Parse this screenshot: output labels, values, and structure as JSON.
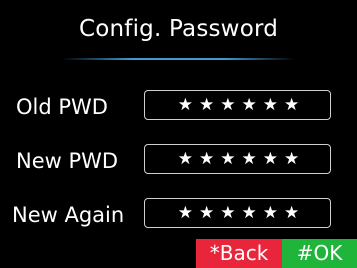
{
  "screen": {
    "title": "Config. Password"
  },
  "form": {
    "fields": [
      {
        "label": "Old PWD",
        "value": "★★★★★★"
      },
      {
        "label": "New PWD",
        "value": "★★★★★★"
      },
      {
        "label": "New Again",
        "value": "★★★★★★"
      }
    ]
  },
  "softkeys": {
    "back_label": "*Back",
    "ok_label": "#OK"
  },
  "colors": {
    "background": "#000000",
    "title_rule": "#3e9bd0",
    "back_key": "#e8253a",
    "ok_key": "#1fb43a"
  }
}
